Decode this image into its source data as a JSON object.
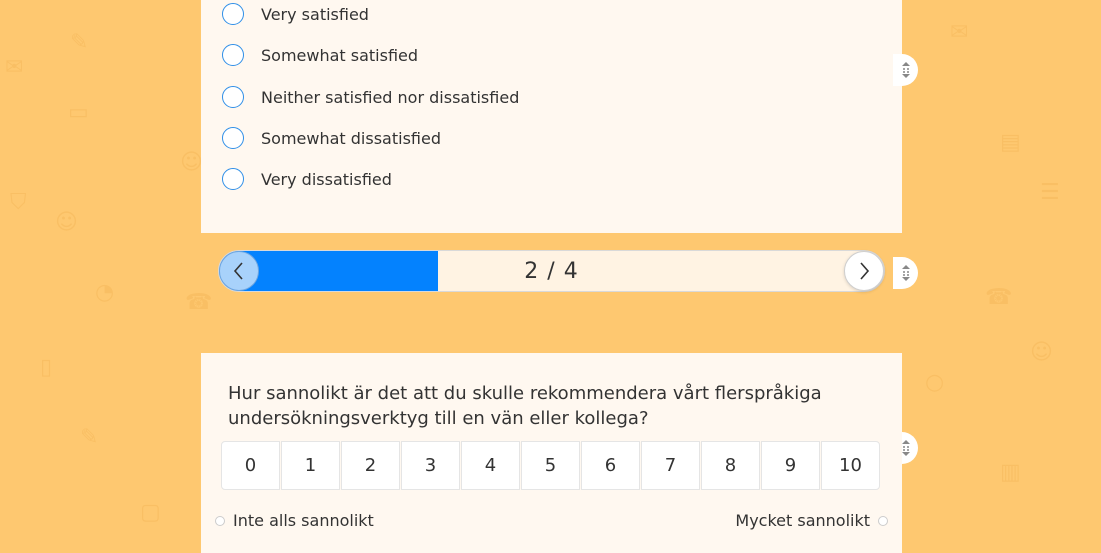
{
  "survey": {
    "options": [
      {
        "label": "Very satisfied"
      },
      {
        "label": "Somewhat satisfied"
      },
      {
        "label": "Neither satisfied nor dissatisfied"
      },
      {
        "label": "Somewhat dissatisfied"
      },
      {
        "label": "Very dissatisfied"
      }
    ],
    "progress": {
      "text": "2 / 4",
      "fraction": 0.33
    },
    "nps": {
      "question": "Hur sannolikt är det att du skulle rekommendera vårt flerspråkiga undersökningsverktyg till en vän eller kollega?",
      "scale": [
        "0",
        "1",
        "2",
        "3",
        "4",
        "5",
        "6",
        "7",
        "8",
        "9",
        "10"
      ],
      "low_label": "Inte alls sannolikt",
      "high_label": "Mycket sannolikt"
    }
  },
  "colors": {
    "background": "#fec870",
    "card": "#fff8f0",
    "accent": "#0482fe"
  },
  "icons": [
    "chevron-left-icon",
    "chevron-right-icon",
    "drag-handle-icon"
  ]
}
